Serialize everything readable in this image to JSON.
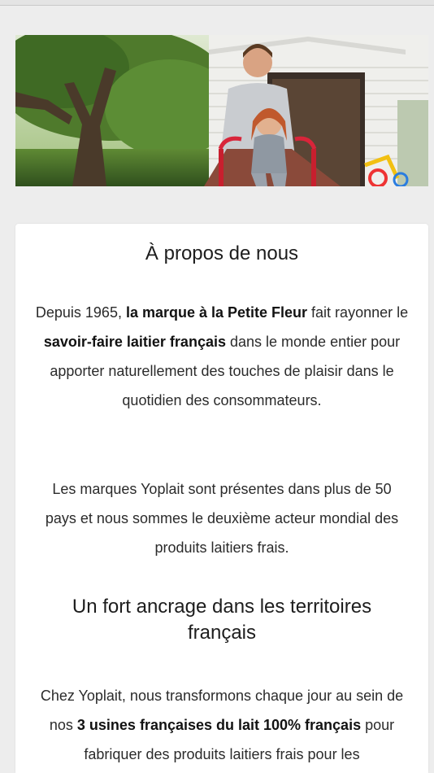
{
  "hero": {
    "image_description_icon": "family-photo"
  },
  "about": {
    "title": "À propos de nous",
    "p1_a": "Depuis 1965, ",
    "p1_b": "la marque à la Petite Fleur",
    "p1_c": " fait rayonner le ",
    "p1_d": "savoir-faire laitier français",
    "p1_e": " dans le monde entier pour apporter naturellement des touches de plaisir dans le quotidien des consommateurs.",
    "p2": "Les marques Yoplait sont présentes dans plus de 50 pays et nous sommes le deuxième acteur mondial des produits laitiers frais.",
    "subtitle": "Un fort ancrage dans les territoires français",
    "p3_a": "Chez Yoplait, nous transformons chaque jour au sein de nos ",
    "p3_b": "3 usines françaises du lait 100% français",
    "p3_c": " pour fabriquer des produits laitiers frais pour les"
  },
  "colors": {
    "page_bg": "#ededed",
    "card_bg": "#ffffff",
    "text": "#2b2b2b"
  }
}
